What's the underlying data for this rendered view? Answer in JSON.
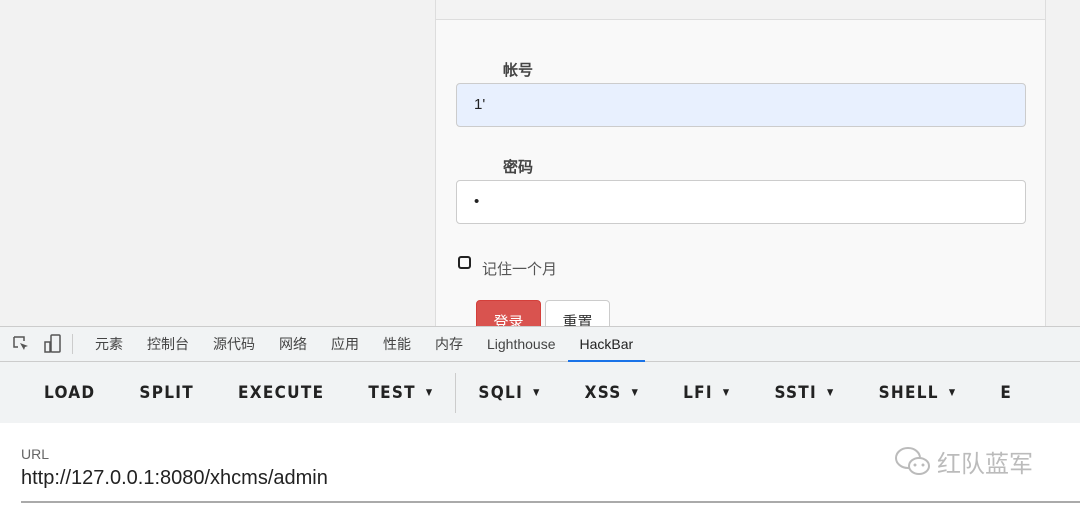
{
  "form": {
    "username_label": "帐号",
    "username_value": "1'",
    "password_label": "密码",
    "password_value": "•",
    "remember_label": "记住一个月",
    "login_button": "登录",
    "reset_button": "重置"
  },
  "devtools": {
    "tabs": [
      "元素",
      "控制台",
      "源代码",
      "网络",
      "应用",
      "性能",
      "内存",
      "Lighthouse",
      "HackBar"
    ],
    "active_tab": "HackBar"
  },
  "hackbar": {
    "buttons": [
      {
        "label": "LOAD"
      },
      {
        "label": "SPLIT"
      },
      {
        "label": "EXECUTE"
      },
      {
        "label": "TEST",
        "dropdown": true
      },
      {
        "label": "SQLI",
        "dropdown": true
      },
      {
        "label": "XSS",
        "dropdown": true
      },
      {
        "label": "LFI",
        "dropdown": true
      },
      {
        "label": "SSTI",
        "dropdown": true
      },
      {
        "label": "SHELL",
        "dropdown": true
      },
      {
        "label": "E"
      }
    ],
    "url_label": "URL",
    "url_value": "http://127.0.0.1:8080/xhcms/admin"
  },
  "watermark": "红队蓝军",
  "colors": {
    "login_button": "#d9534f",
    "active_tab": "#1a73e8",
    "autofill": "#e8f0fe"
  }
}
